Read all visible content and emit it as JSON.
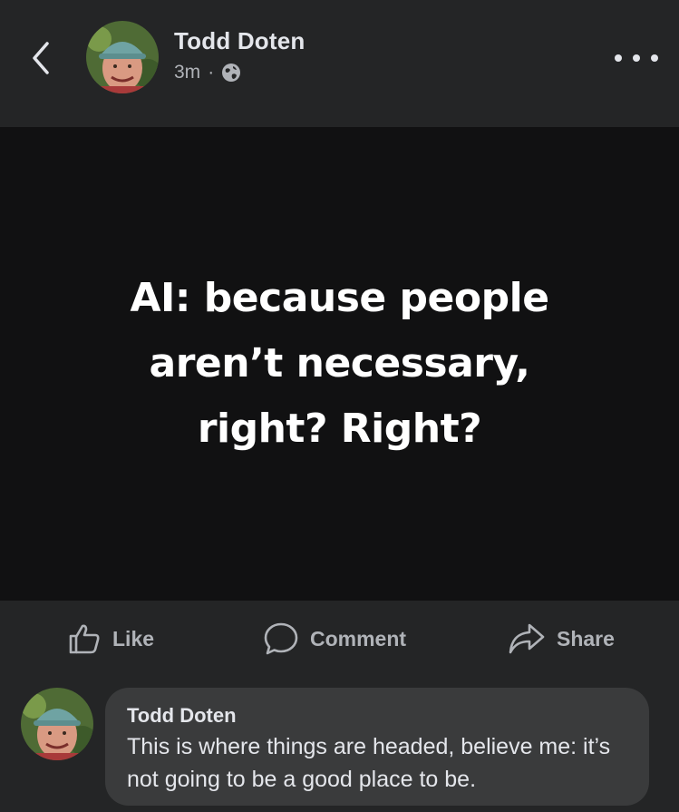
{
  "header": {
    "author_name": "Todd Doten",
    "timestamp": "3m",
    "separator": "·",
    "privacy_icon": "globe-icon",
    "back_icon": "chevron-left-icon",
    "more_icon": "more-horizontal-icon"
  },
  "post": {
    "text": "AI: because people\naren’t necessary,\nright? Right?"
  },
  "actions": {
    "like_label": "Like",
    "comment_label": "Comment",
    "share_label": "Share"
  },
  "comment": {
    "author": "Todd Doten",
    "text": "This is where things are headed, believe me: it’s not going to be a good place to be."
  },
  "colors": {
    "background": "#242526",
    "post_background": "#111112",
    "bubble": "#3a3b3c",
    "primary_text": "#e4e6eb",
    "secondary_text": "#b0b3b8"
  }
}
